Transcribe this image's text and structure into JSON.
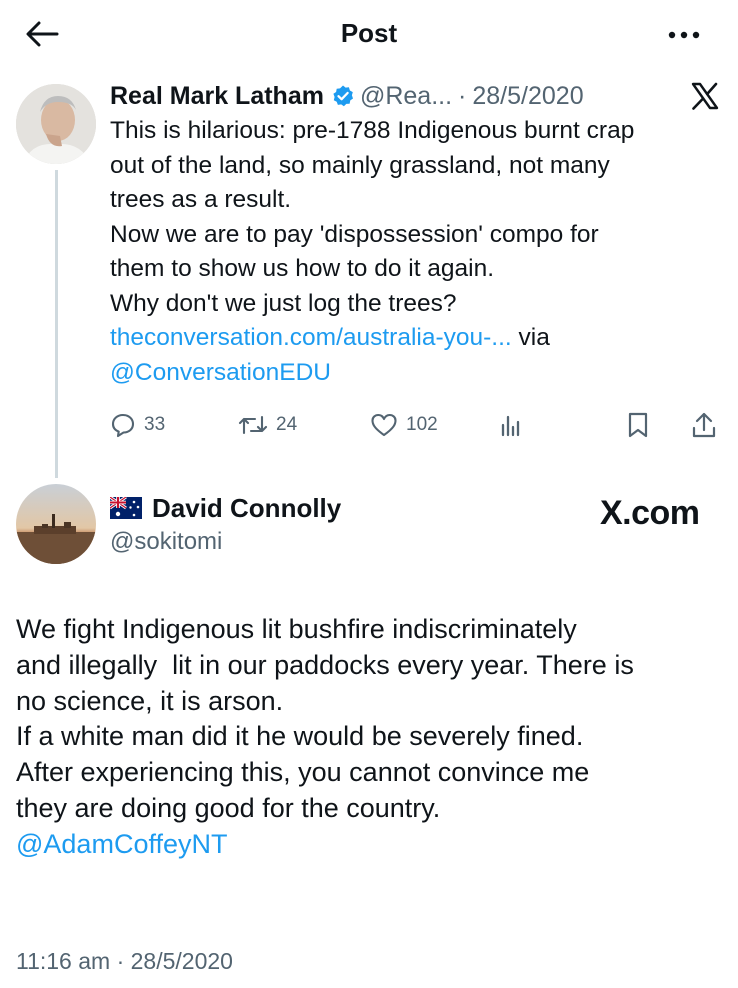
{
  "header": {
    "title": "Post"
  },
  "quoted_tweet": {
    "author_name": "Real Mark Latham",
    "handle": "@Rea...",
    "dot": "·",
    "date": "28/5/2020",
    "lines": [
      "This is hilarious: pre-1788 Indigenous burnt crap",
      "out of the land, so mainly grassland, not many",
      "trees as a result.",
      "Now we are to pay 'dispossession' compo for",
      "them to show us how to do it again.",
      "Why don't we just log the trees?"
    ],
    "link_text": "theconversation.com/australia-you-...",
    "via_text": " via",
    "mention": "@ConversationEDU",
    "stats": {
      "replies": "33",
      "retweets": "24",
      "likes": "102"
    }
  },
  "main_tweet": {
    "author_name": "David Connolly",
    "handle": "@sokitomi",
    "watermark": "X.com",
    "lines": [
      "We fight Indigenous lit bushfire indiscriminately",
      "and illegally  lit in our paddocks every year. There is",
      "no science, it is arson.",
      "If a white man did it he would be severely fined.",
      "After experiencing this, you cannot convince me",
      "they are doing good for the country."
    ],
    "mention": "@AdamCoffeyNT",
    "timestamp": "11:16 am · 28/5/2020"
  },
  "colors": {
    "link": "#1d9bf0",
    "verified": "#1d9bf0",
    "muted": "#536471",
    "thread_line": "#cfd9de"
  },
  "icons": [
    "back-arrow-icon",
    "more-icon",
    "verified-badge-icon",
    "x-logo-icon",
    "reply-icon",
    "retweet-icon",
    "like-icon",
    "views-icon",
    "bookmark-icon",
    "share-icon",
    "australia-flag-icon"
  ]
}
